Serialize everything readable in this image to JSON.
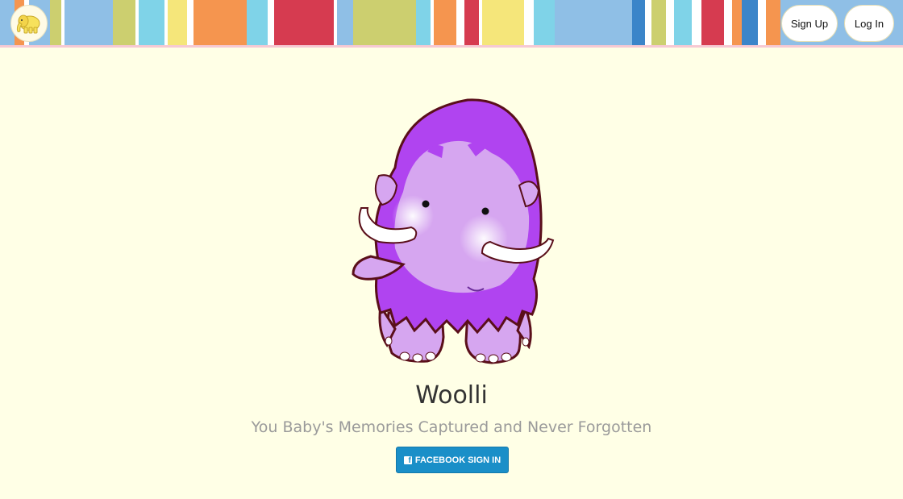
{
  "header": {
    "signup_label": "Sign Up",
    "login_label": "Log In",
    "logo_icon": "elephant-icon",
    "stripe_colors": [
      "#8fbfe6",
      "#f5954f",
      "#cccf6f",
      "#7fd3e8",
      "#f5e67a",
      "#d63b50",
      "#3b85c9",
      "#ffffff"
    ]
  },
  "hero": {
    "title": "Woolli",
    "tagline": "You Baby's Memories Captured and Never Forgotten",
    "mascot_icon": "woolly-mammoth-illustration"
  },
  "auth": {
    "facebook_label": "FACEBOOK SIGN IN",
    "facebook_icon": "facebook-icon",
    "facebook_color": "#1a8fc8"
  }
}
